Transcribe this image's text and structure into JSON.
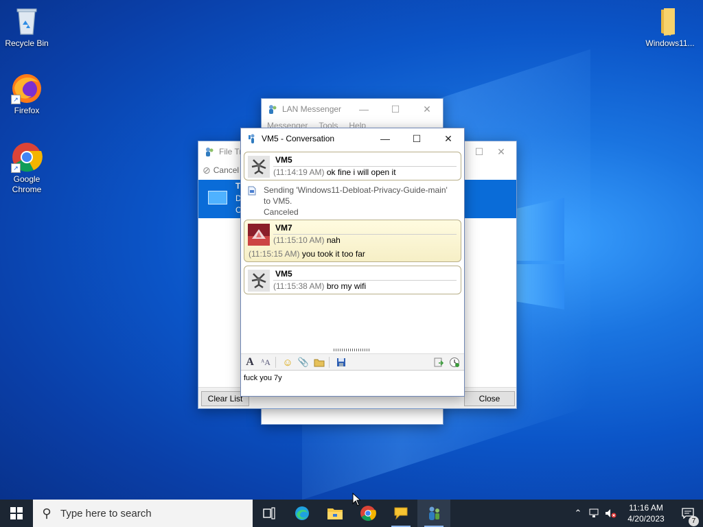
{
  "desktop": {
    "icons": [
      {
        "label": "Recycle Bin"
      },
      {
        "label": "Firefox"
      },
      {
        "label": "Google Chrome"
      },
      {
        "label": "Windows11..."
      }
    ]
  },
  "lan_messenger": {
    "title": "LAN Messenger",
    "menu": [
      "Messenger",
      "Tools",
      "Help"
    ]
  },
  "file_transfer": {
    "title": "File Tra",
    "cancel_label": "Cancel",
    "row_lines": [
      "T",
      "D",
      "C"
    ],
    "clear_list_label": "Clear List",
    "close_label": "Close"
  },
  "conversation": {
    "title": "VM5 - Conversation",
    "messages": [
      {
        "sender": "VM5",
        "lines": [
          {
            "time": "(11:14:19 AM)",
            "text": "ok fine i will open it"
          }
        ]
      },
      {
        "system": [
          "Sending 'Windows11-Debloat-Privacy-Guide-main'",
          "to VM5.",
          "Canceled"
        ]
      },
      {
        "sender": "VM7",
        "lines": [
          {
            "time": "(11:15:10 AM)",
            "text": "nah"
          },
          {
            "time": "(11:15:15 AM)",
            "text": "you took it too far"
          }
        ]
      },
      {
        "sender": "VM5",
        "lines": [
          {
            "time": "(11:15:38 AM)",
            "text": "bro my wifi"
          }
        ]
      }
    ],
    "input_text": "fuck you 7y"
  },
  "taskbar": {
    "search_placeholder": "Type here to search",
    "clock_time": "11:16 AM",
    "clock_date": "4/20/2023",
    "notification_count": "7"
  },
  "colors": {
    "selection": "#0a6cd8",
    "taskbar": "#1c2633",
    "bubble_border": "#b7ae88"
  }
}
